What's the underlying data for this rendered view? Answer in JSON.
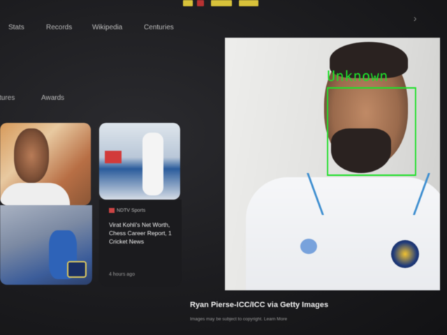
{
  "top_logo": {
    "colors": [
      "#d8c23a",
      "#b83232",
      "#d8c23a",
      "#d8c23a"
    ]
  },
  "nav": {
    "items": [
      {
        "label": "Stats"
      },
      {
        "label": "Records"
      },
      {
        "label": "Wikipedia"
      },
      {
        "label": "Centuries"
      }
    ],
    "scroll_icon": "chevron-right-icon"
  },
  "chips": [
    {
      "label": "tures"
    },
    {
      "label": "Awards"
    }
  ],
  "news": {
    "source": "NDTV Sports",
    "headline": "Virat Kohli's Net Worth, Chess Career Report, 1 Cricket News",
    "time": "4 hours ago"
  },
  "detection": {
    "label": "Unknown",
    "color": "#1fe02a"
  },
  "main_image": {
    "caption": "Ryan Pierse-ICC/ICC via Getty Images",
    "sub_caption": "Images may be subject to copyright. Learn More"
  }
}
